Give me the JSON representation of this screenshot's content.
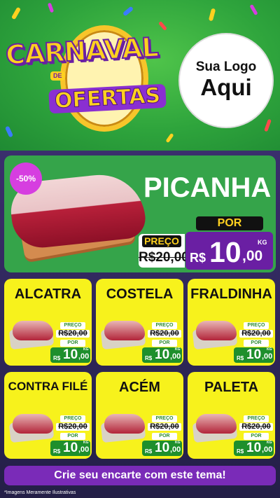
{
  "header": {
    "banner_line1": "CARNAVAL",
    "banner_connector": "DE",
    "banner_line2": "OFERTAS",
    "logo_placeholder_line1": "Sua Logo",
    "logo_placeholder_line2": "Aqui"
  },
  "featured": {
    "name": "PICANHA",
    "discount_badge": "-50%",
    "preco_label": "PREÇO",
    "old_price": "R$20,00",
    "por_label": "POR",
    "currency": "R$",
    "price_int": "10",
    "price_dec": ",00",
    "unit": "KG"
  },
  "products": [
    {
      "name": "ALCATRA",
      "preco_label": "PREÇO",
      "old_price": "R$20,00",
      "por_label": "POR",
      "currency": "R$",
      "price_int": "10",
      "price_dec": ",00",
      "unit": "KG"
    },
    {
      "name": "COSTELA",
      "preco_label": "PREÇO",
      "old_price": "R$20,00",
      "por_label": "POR",
      "currency": "R$",
      "price_int": "10",
      "price_dec": ",00",
      "unit": "KG"
    },
    {
      "name": "FRALDINHA",
      "preco_label": "PREÇO",
      "old_price": "R$20,00",
      "por_label": "POR",
      "currency": "R$",
      "price_int": "10",
      "price_dec": ",00",
      "unit": "KG"
    },
    {
      "name": "CONTRA FILÉ",
      "preco_label": "PREÇO",
      "old_price": "R$20,00",
      "por_label": "POR",
      "currency": "R$",
      "price_int": "10",
      "price_dec": ",00",
      "unit": "KG"
    },
    {
      "name": "ACÉM",
      "preco_label": "PREÇO",
      "old_price": "R$20,00",
      "por_label": "POR",
      "currency": "R$",
      "price_int": "10",
      "price_dec": ",00",
      "unit": "KG"
    },
    {
      "name": "PALETA",
      "preco_label": "PREÇO",
      "old_price": "R$20,00",
      "por_label": "POR",
      "currency": "R$",
      "price_int": "10",
      "price_dec": ",00",
      "unit": "KG"
    }
  ],
  "cta_label": "Crie seu encarte com este tema!",
  "disclaimer": "*Imagens Meramente Ilustrativas",
  "colors": {
    "hero_green": "#2ea43c",
    "card_yellow": "#f7f21c",
    "accent_purple": "#7a2bb8",
    "price_green": "#1e8f2c"
  }
}
